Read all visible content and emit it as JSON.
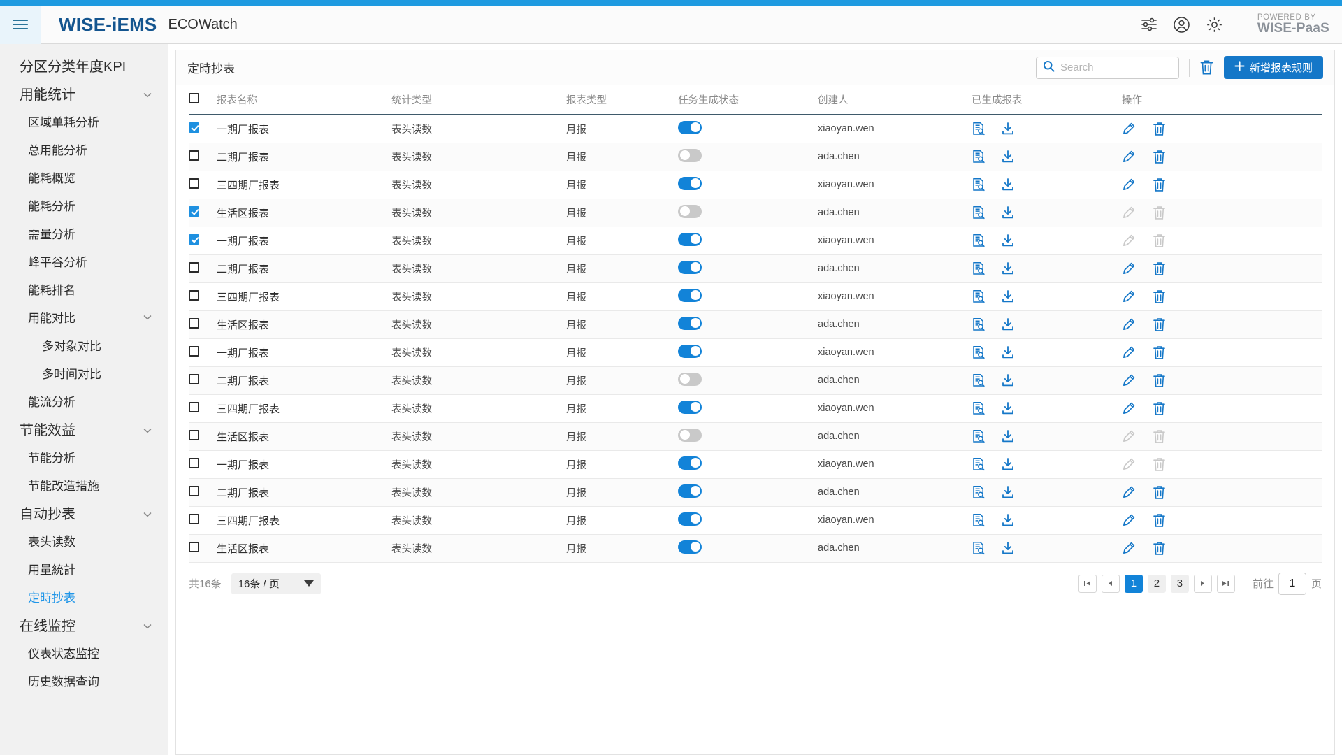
{
  "theme": {
    "accent": "#1e9ae0",
    "primary": "#1477c8",
    "brand_blue": "#14558f",
    "toggle_on": "#1283d8"
  },
  "header": {
    "menu_icon": "hamburger-icon",
    "brand": "WISE-iEMS",
    "app_name": "ECOWatch",
    "icons": [
      "sliders-icon",
      "user-account-icon",
      "gear-icon"
    ],
    "powered_by_label": "POWERED BY",
    "powered_by_name": "WISE-PaaS"
  },
  "sidebar": {
    "items": [
      {
        "label": "分区分类年度KPI",
        "level": 0,
        "chevron": false,
        "active": false
      },
      {
        "label": "用能统计",
        "level": 0,
        "chevron": true,
        "active": false
      },
      {
        "label": "区域单耗分析",
        "level": 1,
        "chevron": false,
        "active": false
      },
      {
        "label": "总用能分析",
        "level": 1,
        "chevron": false,
        "active": false
      },
      {
        "label": "能耗概览",
        "level": 1,
        "chevron": false,
        "active": false
      },
      {
        "label": "能耗分析",
        "level": 1,
        "chevron": false,
        "active": false
      },
      {
        "label": "需量分析",
        "level": 1,
        "chevron": false,
        "active": false
      },
      {
        "label": "峰平谷分析",
        "level": 1,
        "chevron": false,
        "active": false
      },
      {
        "label": "能耗排名",
        "level": 1,
        "chevron": false,
        "active": false
      },
      {
        "label": "用能对比",
        "level": 1,
        "chevron": true,
        "active": false
      },
      {
        "label": "多对象对比",
        "level": 2,
        "chevron": false,
        "active": false
      },
      {
        "label": "多时间对比",
        "level": 2,
        "chevron": false,
        "active": false
      },
      {
        "label": "能流分析",
        "level": 1,
        "chevron": false,
        "active": false
      },
      {
        "label": "节能效益",
        "level": 0,
        "chevron": true,
        "active": false
      },
      {
        "label": "节能分析",
        "level": 1,
        "chevron": false,
        "active": false
      },
      {
        "label": "节能改造措施",
        "level": 1,
        "chevron": false,
        "active": false
      },
      {
        "label": "自动抄表",
        "level": 0,
        "chevron": true,
        "active": false
      },
      {
        "label": "表头读数",
        "level": 1,
        "chevron": false,
        "active": false
      },
      {
        "label": "用量統計",
        "level": 1,
        "chevron": false,
        "active": false
      },
      {
        "label": "定時抄表",
        "level": 1,
        "chevron": false,
        "active": true
      },
      {
        "label": "在线监控",
        "level": 0,
        "chevron": true,
        "active": false
      },
      {
        "label": "仪表状态监控",
        "level": 1,
        "chevron": false,
        "active": false
      },
      {
        "label": "历史数据查询",
        "level": 1,
        "chevron": false,
        "active": false
      }
    ]
  },
  "card": {
    "title": "定時抄表",
    "search_placeholder": "Search",
    "search_value": "",
    "delete_icon": "trash-icon",
    "add_button_label": "新增报表规则"
  },
  "table": {
    "headers": [
      "",
      "报表名称",
      "统计类型",
      "报表类型",
      "任务生成状态",
      "创建人",
      "已生成报表",
      "操作"
    ],
    "header_checkbox_checked": false,
    "rows": [
      {
        "checked": true,
        "name": "一期厂报表",
        "stat": "表头读数",
        "rtype": "月报",
        "task_on": true,
        "owner": "xiaoyan.wen",
        "edit_enabled": true,
        "delete_enabled": true
      },
      {
        "checked": false,
        "name": "二期厂报表",
        "stat": "表头读数",
        "rtype": "月报",
        "task_on": false,
        "owner": "ada.chen",
        "edit_enabled": true,
        "delete_enabled": true
      },
      {
        "checked": false,
        "name": "三四期厂报表",
        "stat": "表头读数",
        "rtype": "月报",
        "task_on": true,
        "owner": "xiaoyan.wen",
        "edit_enabled": true,
        "delete_enabled": true
      },
      {
        "checked": true,
        "name": "生活区报表",
        "stat": "表头读数",
        "rtype": "月报",
        "task_on": false,
        "owner": "ada.chen",
        "edit_enabled": false,
        "delete_enabled": false
      },
      {
        "checked": true,
        "name": "一期厂报表",
        "stat": "表头读数",
        "rtype": "月报",
        "task_on": true,
        "owner": "xiaoyan.wen",
        "edit_enabled": false,
        "delete_enabled": false
      },
      {
        "checked": false,
        "name": "二期厂报表",
        "stat": "表头读数",
        "rtype": "月报",
        "task_on": true,
        "owner": "ada.chen",
        "edit_enabled": true,
        "delete_enabled": true
      },
      {
        "checked": false,
        "name": "三四期厂报表",
        "stat": "表头读数",
        "rtype": "月报",
        "task_on": true,
        "owner": "xiaoyan.wen",
        "edit_enabled": true,
        "delete_enabled": true
      },
      {
        "checked": false,
        "name": "生活区报表",
        "stat": "表头读数",
        "rtype": "月报",
        "task_on": true,
        "owner": "ada.chen",
        "edit_enabled": true,
        "delete_enabled": true
      },
      {
        "checked": false,
        "name": "一期厂报表",
        "stat": "表头读数",
        "rtype": "月报",
        "task_on": true,
        "owner": "xiaoyan.wen",
        "edit_enabled": true,
        "delete_enabled": true
      },
      {
        "checked": false,
        "name": "二期厂报表",
        "stat": "表头读数",
        "rtype": "月报",
        "task_on": false,
        "owner": "ada.chen",
        "edit_enabled": true,
        "delete_enabled": true
      },
      {
        "checked": false,
        "name": "三四期厂报表",
        "stat": "表头读数",
        "rtype": "月报",
        "task_on": true,
        "owner": "xiaoyan.wen",
        "edit_enabled": true,
        "delete_enabled": true
      },
      {
        "checked": false,
        "name": "生活区报表",
        "stat": "表头读数",
        "rtype": "月报",
        "task_on": false,
        "owner": "ada.chen",
        "edit_enabled": false,
        "delete_enabled": false
      },
      {
        "checked": false,
        "name": "一期厂报表",
        "stat": "表头读数",
        "rtype": "月报",
        "task_on": true,
        "owner": "xiaoyan.wen",
        "edit_enabled": false,
        "delete_enabled": false
      },
      {
        "checked": false,
        "name": "二期厂报表",
        "stat": "表头读数",
        "rtype": "月报",
        "task_on": true,
        "owner": "ada.chen",
        "edit_enabled": true,
        "delete_enabled": true
      },
      {
        "checked": false,
        "name": "三四期厂报表",
        "stat": "表头读数",
        "rtype": "月报",
        "task_on": true,
        "owner": "xiaoyan.wen",
        "edit_enabled": true,
        "delete_enabled": true
      },
      {
        "checked": false,
        "name": "生活区报表",
        "stat": "表头读数",
        "rtype": "月报",
        "task_on": true,
        "owner": "ada.chen",
        "edit_enabled": true,
        "delete_enabled": true
      }
    ],
    "row_icons": {
      "preview": "report-search-icon",
      "download": "download-icon",
      "edit": "pencil-icon",
      "delete": "trash-icon"
    }
  },
  "pagination": {
    "total_label": "共16条",
    "page_size_label": "16条 / 页",
    "first_icon": "first-page-icon",
    "prev_icon": "prev-page-icon",
    "next_icon": "next-page-icon",
    "last_icon": "last-page-icon",
    "pages": [
      "1",
      "2",
      "3"
    ],
    "current_page": "1",
    "goto_label": "前往",
    "goto_value": "1",
    "goto_unit": "页"
  }
}
